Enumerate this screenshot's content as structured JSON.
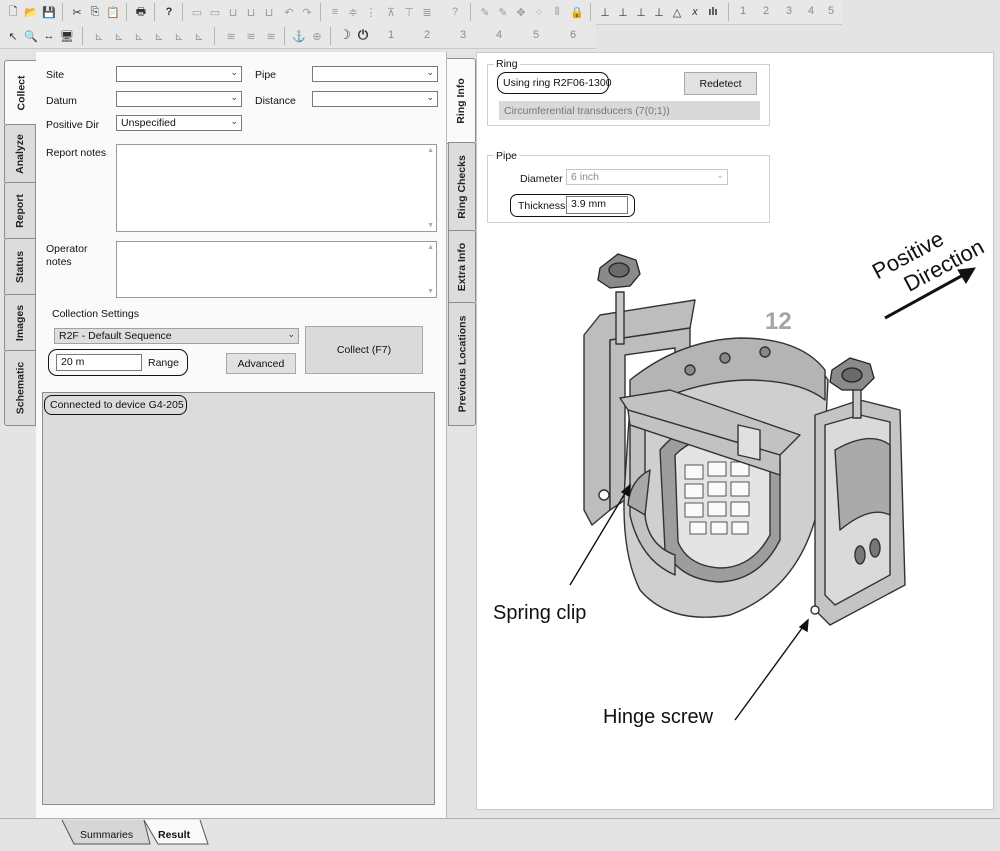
{
  "toolbar1": {
    "icons": [
      "new-icon",
      "open-icon",
      "save-icon",
      "cut-icon",
      "copy-icon",
      "paste-icon",
      "print-icon",
      "help-icon"
    ],
    "numbers": [
      "1",
      "2",
      "3",
      "4",
      "5"
    ]
  },
  "toolbar2": {
    "icons": [
      "pointer-icon",
      "zoom-icon",
      "width-icon",
      "monitor-icon",
      "moon-icon",
      "power-icon"
    ],
    "numbers": [
      "1",
      "2",
      "3",
      "4",
      "5",
      "6"
    ]
  },
  "left_tabs": [
    "Collect",
    "Analyze",
    "Report",
    "Status",
    "Images",
    "Schematic"
  ],
  "form": {
    "site_label": "Site",
    "site_value": "",
    "pipe_label": "Pipe",
    "pipe_value": "",
    "datum_label": "Datum",
    "datum_value": "",
    "distance_label": "Distance",
    "distance_value": "",
    "positive_dir_label": "Positive Dir",
    "positive_dir_value": "Unspecified",
    "report_notes_label": "Report notes",
    "operator_notes_label": "Operator\nnotes"
  },
  "collection": {
    "label": "Collection Settings",
    "sequence": "R2F - Default Sequence",
    "range_value": "20 m",
    "range_label": "Range",
    "advanced_button": "Advanced",
    "collect_button": "Collect (F7)",
    "status": "Connected to device G4-205"
  },
  "middle_tabs": [
    "Ring Info",
    "Ring Checks",
    "Extra Info",
    "Previous Locations"
  ],
  "ring": {
    "group_label": "Ring",
    "using_ring": "Using ring R2F06-1300",
    "redetect_button": "Redetect",
    "transducers": "Circumferential transducers (7(0;1))"
  },
  "pipe": {
    "group_label": "Pipe",
    "diameter_label": "Diameter",
    "diameter_value": "6 inch",
    "thickness_label": "Thickness",
    "thickness_value": "3.9 mm"
  },
  "figure": {
    "number": "12",
    "direction_line1": "Positive",
    "direction_line2": "Direction",
    "spring_clip": "Spring clip",
    "hinge_screw": "Hinge screw"
  },
  "bottom_tabs": [
    "Summaries",
    "Result"
  ]
}
